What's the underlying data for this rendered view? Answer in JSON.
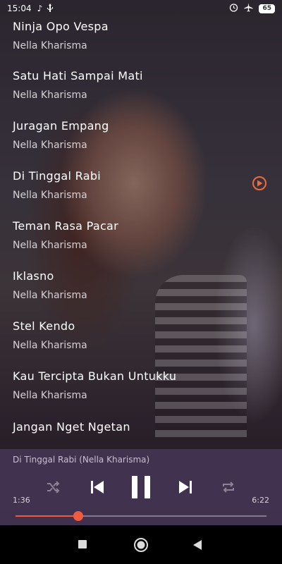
{
  "status_bar": {
    "time": "15:04",
    "icons_left": [
      "music-note-icon",
      "usb-icon"
    ],
    "icons_right": [
      "alarm-icon",
      "airplane-icon"
    ],
    "battery": "65"
  },
  "songs": [
    {
      "title": "Ninja Opo Vespa",
      "artist": "Nella Kharisma"
    },
    {
      "title": "Satu Hati Sampai Mati",
      "artist": "Nella Kharisma"
    },
    {
      "title": "Juragan Empang",
      "artist": "Nella Kharisma"
    },
    {
      "title": "Di Tinggal Rabi",
      "artist": "Nella Kharisma"
    },
    {
      "title": "Teman Rasa Pacar",
      "artist": "Nella Kharisma"
    },
    {
      "title": "Iklasno",
      "artist": "Nella Kharisma"
    },
    {
      "title": "Stel Kendo",
      "artist": "Nella Kharisma"
    },
    {
      "title": "Kau Tercipta Bukan Untukku",
      "artist": "Nella Kharisma"
    },
    {
      "title": "Jangan Nget Ngetan",
      "artist": ""
    }
  ],
  "player": {
    "now_playing": "Di Tinggal Rabi (Nella Kharisma)",
    "current_time": "1:36",
    "total_time": "6:22",
    "progress": 0.25,
    "accent": "#ef5b3f"
  },
  "nav": {
    "icons": [
      "recent-apps-icon",
      "home-icon",
      "back-icon"
    ]
  }
}
